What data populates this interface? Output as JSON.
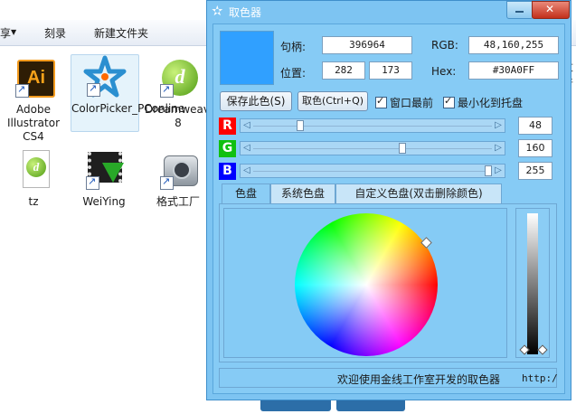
{
  "explorer": {
    "toolbar": {
      "menu_frag": "享",
      "burn": "刻录",
      "new_folder": "新建文件夹"
    },
    "items": [
      {
        "label": "Adobe Illustrator CS4",
        "icon": "illustrator-icon"
      },
      {
        "label": "ColorPicker_PConline",
        "icon": "colorpicker-star-icon"
      },
      {
        "label": "Dreamweaver 8",
        "icon": "dreamweaver-icon"
      },
      {
        "label": "tz",
        "icon": "dreamweaver-doc-icon"
      },
      {
        "label": "WeiYing",
        "icon": "video-download-icon"
      },
      {
        "label": "格式工厂",
        "icon": "format-factory-icon"
      }
    ],
    "right_frag": {
      "a": "文件",
      "b": "V"
    }
  },
  "picker": {
    "title": "取色器",
    "color_hex": "#30A0FF",
    "handle_label": "句柄:",
    "handle_value": "396964",
    "rgb_label": "RGB:",
    "rgb_value": "48,160,255",
    "pos_label": "位置:",
    "pos_x": "282",
    "pos_y": "173",
    "hex_label": "Hex:",
    "hex_value": "#30A0FF",
    "save_button": "保存此色(S)",
    "pick_button": "取色(Ctrl+Q)",
    "topmost_label": "窗口最前",
    "tray_label": "最小化到托盘",
    "channels": [
      {
        "name": "R",
        "value": "48",
        "color": "#ff0000",
        "level": 0.188
      },
      {
        "name": "G",
        "value": "160",
        "color": "#10c010",
        "level": 0.627
      },
      {
        "name": "B",
        "value": "255",
        "color": "#0000ff",
        "level": 1.0
      }
    ],
    "tabs": [
      "色盘",
      "系统色盘",
      "自定义色盘(双击删除颜色)"
    ],
    "status_msg": "欢迎使用金线工作室开发的取色器",
    "status_url": "http:/"
  }
}
